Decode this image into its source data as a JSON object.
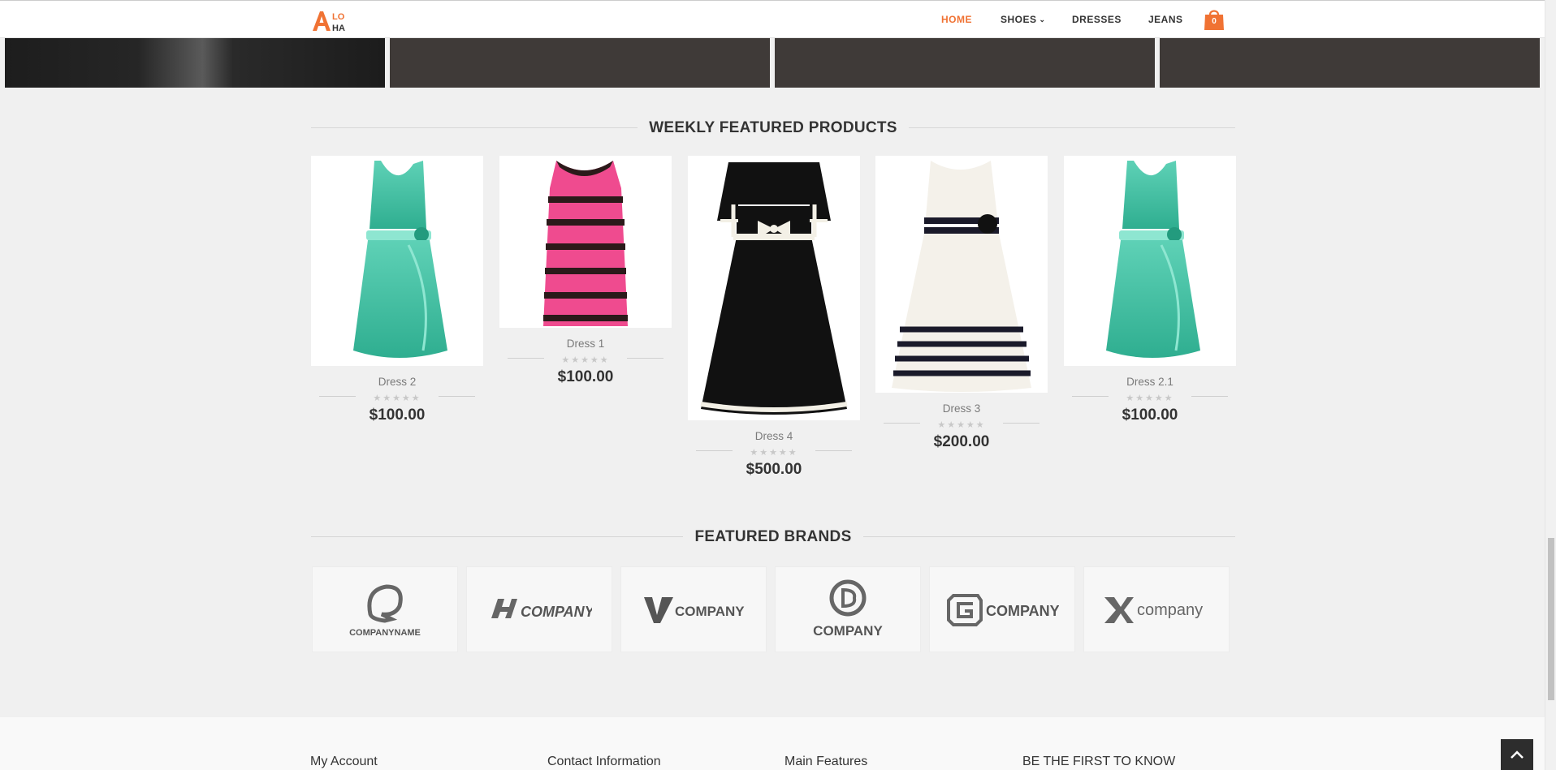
{
  "brand": {
    "logo_letters": [
      "A",
      "LO",
      "HA"
    ],
    "accent_color": "#f07233"
  },
  "nav": {
    "items": [
      {
        "label": "HOME",
        "active": true
      },
      {
        "label": "SHOES",
        "dropdown": true
      },
      {
        "label": "DRESSES"
      },
      {
        "label": "JEANS"
      }
    ],
    "cart_count": "0",
    "cart_icon": "shopping-bag-icon"
  },
  "featured_products": {
    "title": "WEEKLY FEATURED PRODUCTS",
    "items": [
      {
        "name": "Dress 2",
        "price": "$100.00",
        "rating": 0
      },
      {
        "name": "Dress 1",
        "price": "$100.00",
        "rating": 0
      },
      {
        "name": "Dress 4",
        "price": "$500.00",
        "rating": 0
      },
      {
        "name": "Dress 3",
        "price": "$200.00",
        "rating": 0
      },
      {
        "name": "Dress 2.1",
        "price": "$100.00",
        "rating": 0
      }
    ],
    "stars": "★★★★★"
  },
  "featured_brands": {
    "title": "FEATURED BRANDS",
    "items": [
      {
        "label": "COMPANYNAME"
      },
      {
        "label": "COMPANY"
      },
      {
        "label": "COMPANY"
      },
      {
        "label": "COMPANY"
      },
      {
        "label": "COMPANY"
      },
      {
        "label": "company"
      }
    ]
  },
  "footer": {
    "columns": [
      "My Account",
      "Contact Information",
      "Main Features",
      "BE THE FIRST TO KNOW"
    ]
  }
}
